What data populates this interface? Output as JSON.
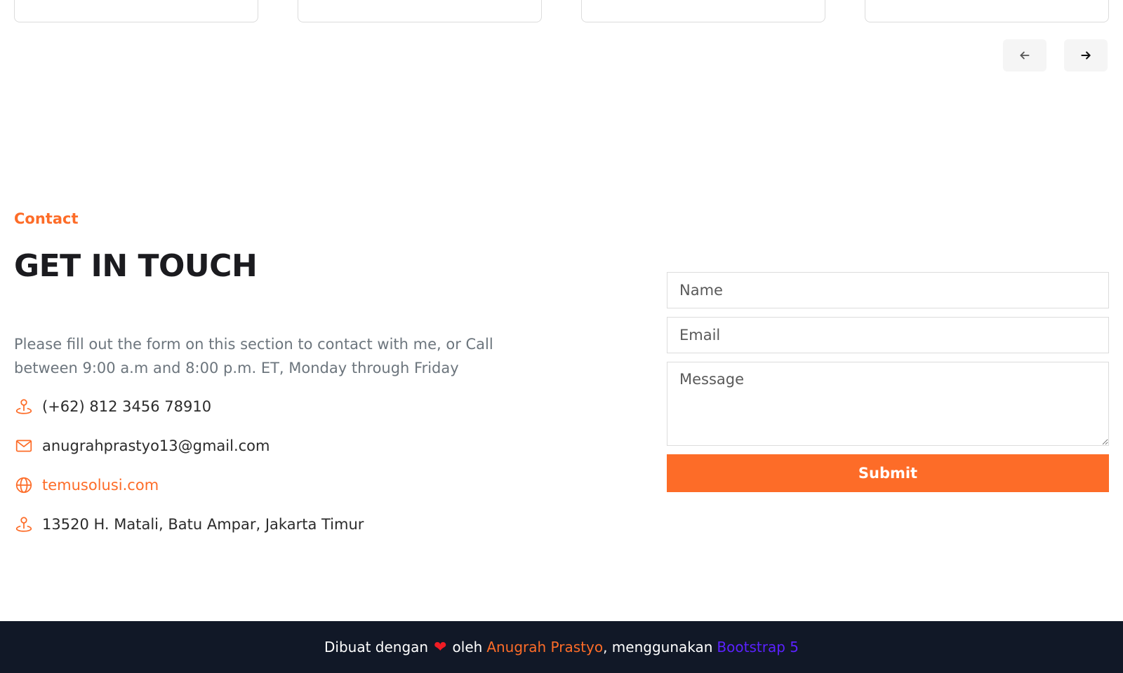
{
  "carousel": {
    "prev_icon": "arrow-left-icon",
    "next_icon": "arrow-right-icon"
  },
  "contact": {
    "eyebrow": "Contact",
    "heading": "GET IN TOUCH",
    "description": "Please fill out the form on this section to contact with me, or Call between 9:00 a.m and 8:00 p.m. ET, Monday through Friday",
    "items": [
      {
        "icon": "map-pin-icon",
        "text": "(+62) 812 3456 78910"
      },
      {
        "icon": "mail-icon",
        "text": "anugrahprastyo13@gmail.com"
      },
      {
        "icon": "globe-icon",
        "text": "temusolusi.com"
      },
      {
        "icon": "map-pin-icon",
        "text": "13520 H. Matali, Batu Ampar, Jakarta Timur"
      }
    ]
  },
  "form": {
    "name_placeholder": "Name",
    "email_placeholder": "Email",
    "message_placeholder": "Message",
    "submit_label": "Submit"
  },
  "footer": {
    "made_with": "Dibuat dengan",
    "heart": "❤",
    "by": "oleh",
    "author": "Anugrah Prastyo",
    "using": ", menggunakan",
    "framework": "Bootstrap 5"
  },
  "colors": {
    "accent": "#fd6c28",
    "footer_bg": "#111827",
    "framework_link": "#5b21ff"
  }
}
